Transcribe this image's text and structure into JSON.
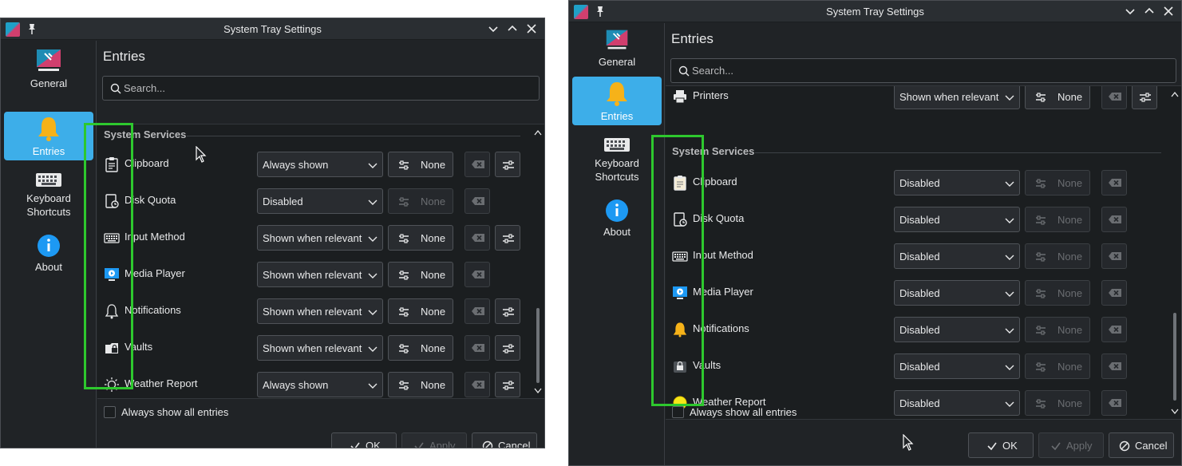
{
  "window_title": "System Tray Settings",
  "sidebar": {
    "items": [
      {
        "label": "General",
        "icon": "general-icon"
      },
      {
        "label": "Entries",
        "icon": "bell-icon"
      },
      {
        "label": "Keyboard Shortcuts",
        "icon": "keyboard-icon"
      },
      {
        "label": "About",
        "icon": "info-icon"
      }
    ]
  },
  "page_title": "Entries",
  "search": {
    "placeholder": "Search..."
  },
  "section_header": "System Services",
  "left": {
    "rows": [
      {
        "name": "Clipboard",
        "icon": "clipboard-icon",
        "visibility": "Always shown",
        "shortcut": "None",
        "shortcut_enabled": true,
        "configurable": true
      },
      {
        "name": "Disk Quota",
        "icon": "disk-quota-icon",
        "visibility": "Disabled",
        "shortcut": "None",
        "shortcut_enabled": false,
        "configurable": false
      },
      {
        "name": "Input Method",
        "icon": "keyboard-icon",
        "visibility": "Shown when relevant",
        "shortcut": "None",
        "shortcut_enabled": true,
        "configurable": true
      },
      {
        "name": "Media Player",
        "icon": "media-player-icon",
        "visibility": "Shown when relevant",
        "shortcut": "None",
        "shortcut_enabled": true,
        "configurable": false
      },
      {
        "name": "Notifications",
        "icon": "bell-icon",
        "visibility": "Shown when relevant",
        "shortcut": "None",
        "shortcut_enabled": true,
        "configurable": true
      },
      {
        "name": "Vaults",
        "icon": "vault-icon",
        "visibility": "Shown when relevant",
        "shortcut": "None",
        "shortcut_enabled": true,
        "configurable": true
      },
      {
        "name": "Weather Report",
        "icon": "sun-icon",
        "visibility": "Always shown",
        "shortcut": "None",
        "shortcut_enabled": true,
        "configurable": true
      }
    ]
  },
  "right": {
    "partial_row": {
      "name": "Printers",
      "icon": "printer-icon",
      "visibility": "Shown when relevant",
      "shortcut": "None"
    },
    "rows": [
      {
        "name": "Clipboard",
        "icon": "clipboard-icon",
        "visibility": "Disabled",
        "shortcut": "None"
      },
      {
        "name": "Disk Quota",
        "icon": "disk-quota-icon",
        "visibility": "Disabled",
        "shortcut": "None"
      },
      {
        "name": "Input Method",
        "icon": "keyboard-icon",
        "visibility": "Disabled",
        "shortcut": "None"
      },
      {
        "name": "Media Player",
        "icon": "media-player-icon",
        "visibility": "Disabled",
        "shortcut": "None"
      },
      {
        "name": "Notifications",
        "icon": "bell-icon",
        "visibility": "Disabled",
        "shortcut": "None"
      },
      {
        "name": "Vaults",
        "icon": "vault-icon",
        "visibility": "Disabled",
        "shortcut": "None"
      },
      {
        "name": "Weather Report",
        "icon": "sun-icon",
        "visibility": "Disabled",
        "shortcut": "None"
      }
    ]
  },
  "always_show_label": "Always show all entries",
  "buttons": {
    "ok": "OK",
    "apply": "Apply",
    "cancel": "Cancel"
  },
  "colors": {
    "accent": "#3daee9",
    "highlight": "#2ec82e",
    "background": "#202326"
  }
}
